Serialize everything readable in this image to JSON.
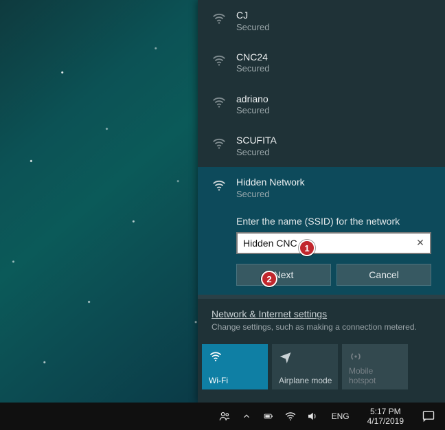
{
  "networks": [
    {
      "name": "CJ",
      "status": "Secured"
    },
    {
      "name": "CNC24",
      "status": "Secured"
    },
    {
      "name": "adriano",
      "status": "Secured"
    },
    {
      "name": "SCUFITA",
      "status": "Secured"
    }
  ],
  "hidden": {
    "name": "Hidden Network",
    "status": "Secured",
    "prompt": "Enter the name (SSID) for the network",
    "ssid_value": "Hidden CNC",
    "next_label": "Next",
    "cancel_label": "Cancel"
  },
  "settings": {
    "link": "Network & Internet settings",
    "sub": "Change settings, such as making a connection metered."
  },
  "tiles": {
    "wifi": "Wi-Fi",
    "airplane": "Airplane mode",
    "hotspot": "Mobile hotspot"
  },
  "tray": {
    "lang": "ENG",
    "time": "5:17 PM",
    "date": "4/17/2019"
  },
  "annotations": {
    "badge1": "1",
    "badge2": "2"
  },
  "colors": {
    "accent": "#0f7fa4",
    "badge": "#c1272d"
  }
}
